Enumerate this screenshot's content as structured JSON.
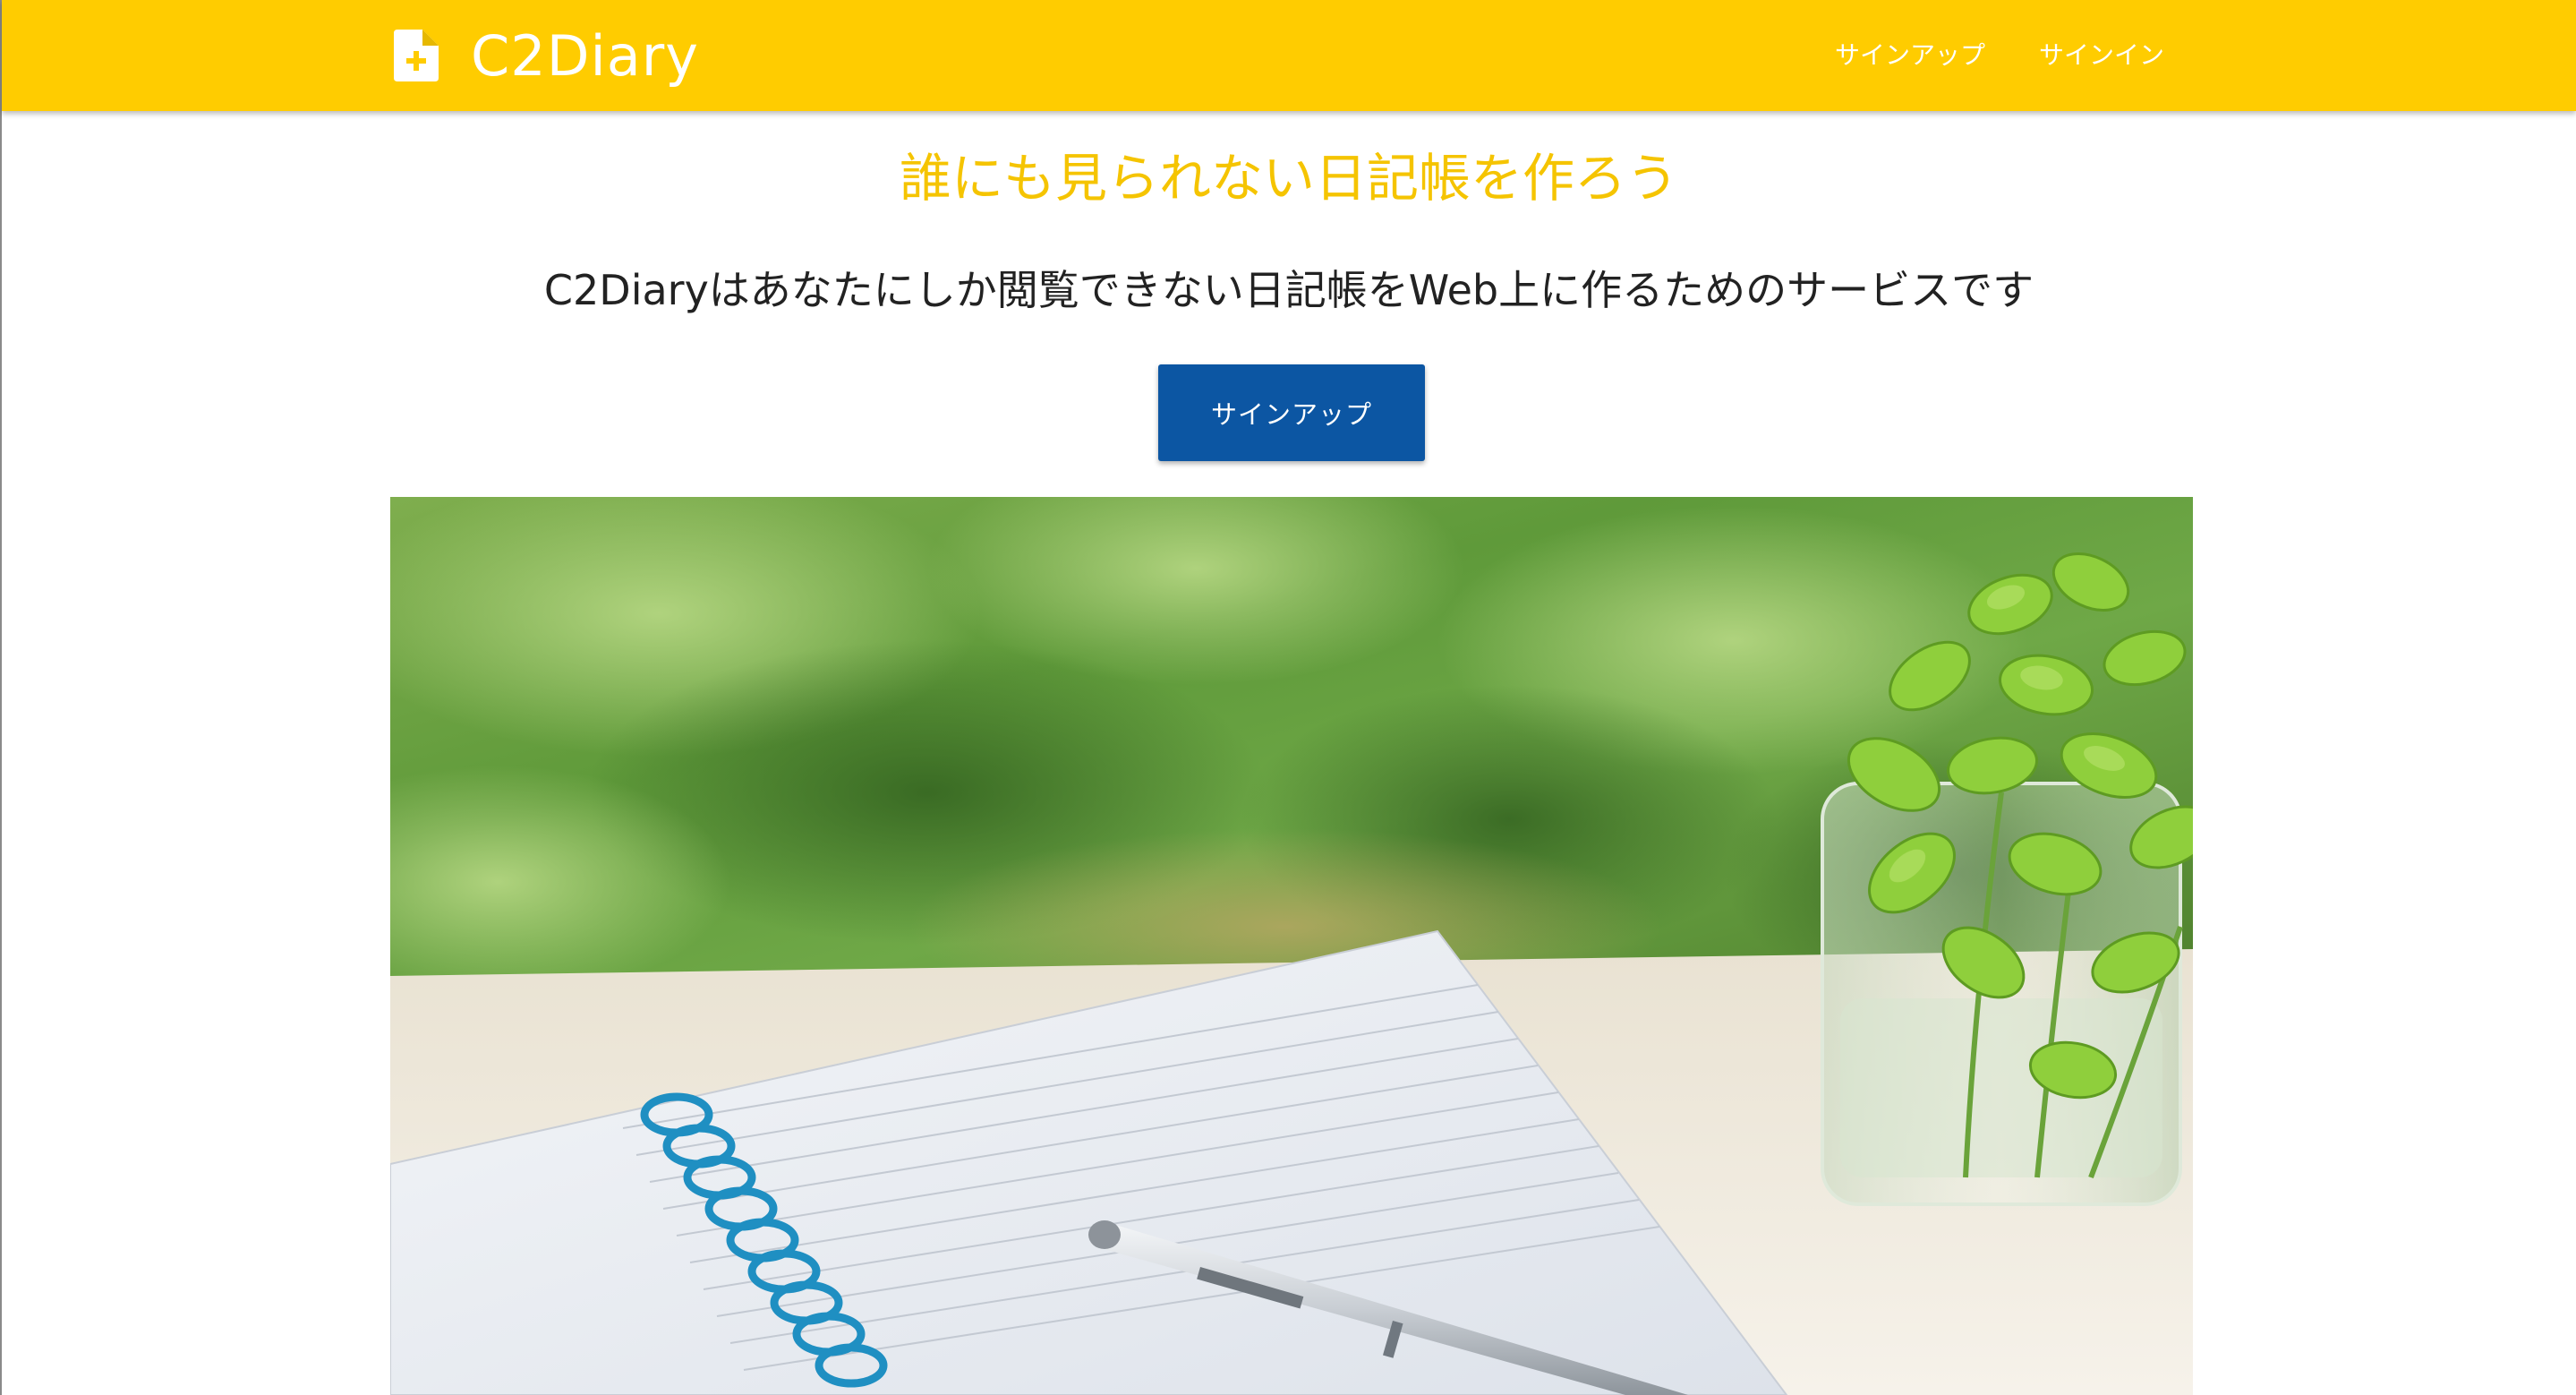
{
  "navbar": {
    "brand_name": "C2Diary",
    "brand_icon": "file-plus-icon",
    "links": [
      {
        "label": "サインアップ"
      },
      {
        "label": "サインイン"
      }
    ]
  },
  "hero": {
    "headline": "誰にも見られない日記帳を作ろう",
    "description": "C2Diaryはあなたにしか閲覧できない日記帳をWeb上に作るためのサービスです",
    "cta_label": "サインアップ",
    "image_subject": "notebook-pen-plant-photo"
  },
  "colors": {
    "navbar_bg": "#ffcc00",
    "headline": "#f5c400",
    "cta_bg": "#0c56a3",
    "text": "#222222"
  }
}
